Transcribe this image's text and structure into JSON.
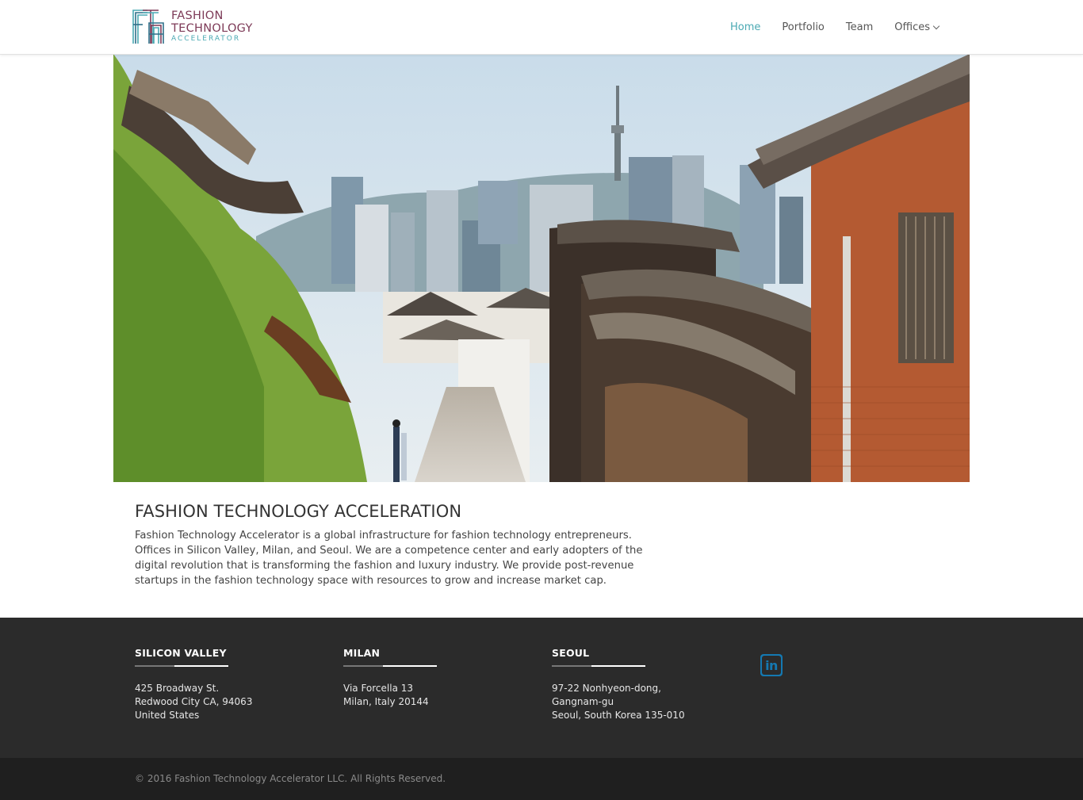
{
  "header": {
    "logo": {
      "line1": "FASHION",
      "line2": "TECHNOLOGY",
      "line3": "ACCELERATOR"
    },
    "nav": [
      {
        "label": "Home",
        "active": true
      },
      {
        "label": "Portfolio"
      },
      {
        "label": "Team"
      },
      {
        "label": "Offices",
        "icon": "chevron-down-icon"
      }
    ]
  },
  "hero": {
    "image_subject": "street with traditional tiled-roof houses and city towers"
  },
  "intro": {
    "title": "FASHION TECHNOLOGY ACCELERATION",
    "body": "Fashion Technology Accelerator is a global infrastructure for fashion technology entrepreneurs. Offices in Silicon Valley, Milan, and Seoul. We are a competence center and early adopters of the digital revolution that is transforming the fashion and luxury industry. We provide post-revenue startups in the fashion technology space with resources to grow and increase market cap."
  },
  "footer": {
    "offices": [
      {
        "title": "SILICON VALLEY",
        "address": [
          "425 Broadway St.",
          "Redwood City CA, 94063",
          "United States"
        ]
      },
      {
        "title": "MILAN",
        "address": [
          "Via Forcella 13",
          "Milan, Italy 20144"
        ]
      },
      {
        "title": "SEOUL",
        "address": [
          "97-22 Nonhyeon-dong,",
          "Gangnam-gu",
          "Seoul, South Korea 135-010"
        ]
      }
    ],
    "social": {
      "icon": "linkedin-icon",
      "glyph": "in"
    },
    "copyright": "© 2016 Fashion Technology Accelerator LLC. All Rights Reserved."
  },
  "colors": {
    "accent": "#4aa9b3",
    "brand": "#7d3a57",
    "footer_bg": "#2b2b2b",
    "copyright_bg": "#1f1f1f",
    "linkedin": "#1479b2"
  }
}
